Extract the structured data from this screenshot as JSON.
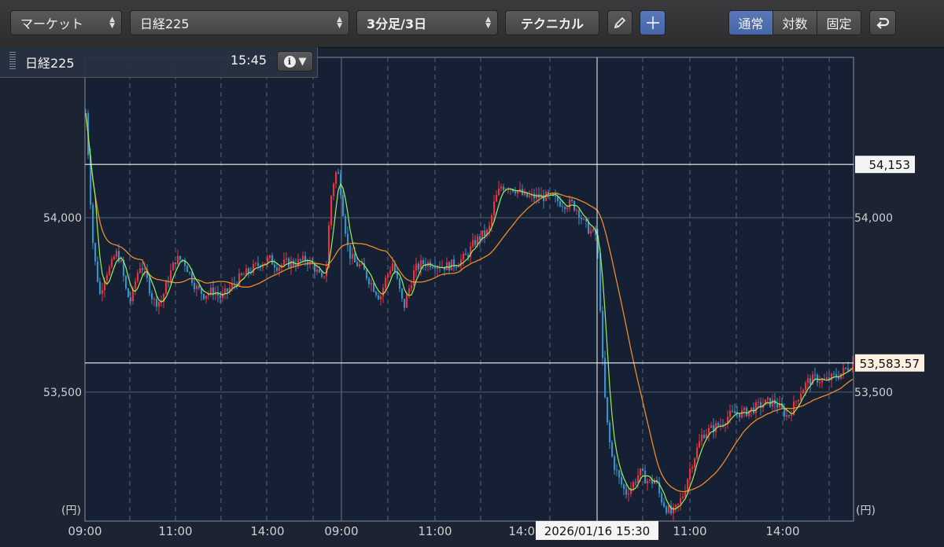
{
  "toolbar": {
    "market_label": "マーケット",
    "symbol_label": "日経225",
    "interval_label": "3分足/3日",
    "technical_label": "テクニカル",
    "pencil_icon": "pencil-icon",
    "crosshair_icon": "crosshair-icon",
    "scale_modes": [
      "通常",
      "対数",
      "固定"
    ],
    "active_scale_mode": "通常",
    "undo_icon": "undo-icon"
  },
  "info": {
    "symbol": "日経225",
    "time": "15:45"
  },
  "chart_data": {
    "type": "candlestick",
    "y_axis_labels": [
      {
        "value": 54000,
        "label": "54,000"
      },
      {
        "value": 53500,
        "label": "53,500"
      }
    ],
    "y_unit": "(円)",
    "ylim": [
      53130,
      54460
    ],
    "x_tick_labels": [
      "09:00",
      "11:00",
      "14:00",
      "09:00",
      "11:00",
      "14:00",
      "11:00",
      "14:00"
    ],
    "horizontal_lines": [
      {
        "value": 54153,
        "label": "54,153"
      },
      {
        "value": 53583.57,
        "label": "53,583.57"
      }
    ],
    "crosshair_label": "2026/01/16 15:30",
    "series_colors": {
      "up": "#e8343f",
      "down": "#3a8fc4",
      "ma_short": "#9af05a",
      "ma_long": "#f08a24"
    }
  }
}
